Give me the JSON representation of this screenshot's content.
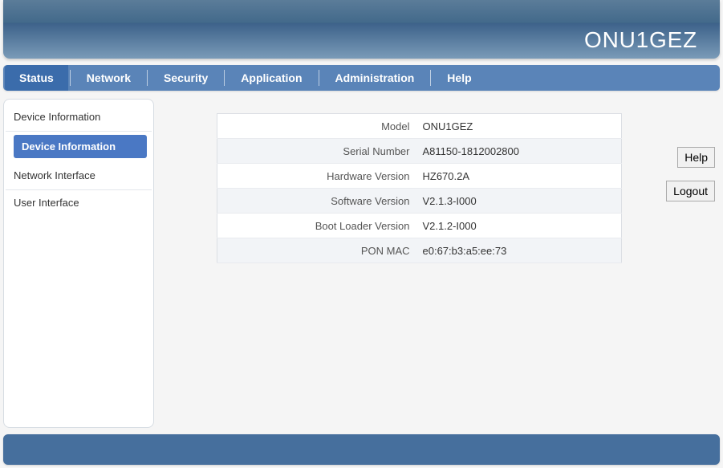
{
  "brand": "ONU1GEZ",
  "nav": {
    "items": [
      {
        "label": "Status",
        "active": true
      },
      {
        "label": "Network",
        "active": false
      },
      {
        "label": "Security",
        "active": false
      },
      {
        "label": "Application",
        "active": false
      },
      {
        "label": "Administration",
        "active": false
      },
      {
        "label": "Help",
        "active": false
      }
    ]
  },
  "sidebar": {
    "groups": [
      {
        "title": "Device Information",
        "items": [
          {
            "label": "Device Information",
            "active": true
          }
        ]
      },
      {
        "title": "Network Interface",
        "items": []
      },
      {
        "title": "User Interface",
        "items": []
      }
    ]
  },
  "device_info": {
    "rows": [
      {
        "label": "Model",
        "value": "ONU1GEZ"
      },
      {
        "label": "Serial Number",
        "value": "A81150-1812002800"
      },
      {
        "label": "Hardware Version",
        "value": "HZ670.2A"
      },
      {
        "label": "Software Version",
        "value": "V2.1.3-I000"
      },
      {
        "label": "Boot Loader Version",
        "value": "V2.1.2-I000"
      },
      {
        "label": "PON MAC",
        "value": "e0:67:b3:a5:ee:73"
      }
    ]
  },
  "buttons": {
    "help": "Help",
    "logout": "Logout"
  }
}
